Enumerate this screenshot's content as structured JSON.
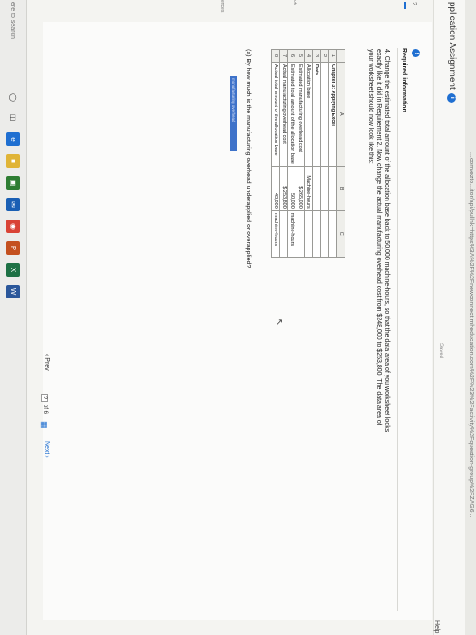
{
  "browser": {
    "url_fragment": "...com/ezto...itor/api/pullnk=https%3A%2F%2Fnewconnect.mheducation.com%2F%23%2Factivity%2Fquestion-group%2FZAG6..."
  },
  "header": {
    "title": "pplication Assignment",
    "info_icon": "i",
    "saved": "Saved",
    "help": "Help"
  },
  "left_nav": {
    "question_number": "2",
    "marks": [
      "ok",
      "ences"
    ]
  },
  "content": {
    "required_icon": "!",
    "required_title": "Required information",
    "instruction": "4. Change the estimated total amount of the allocation base back to 50,000 machine-hours, so that the data area of you worksheet looks exactly like it did in Requirement 2. Now change the actual manufacturing overhead cost from $248,000 to $253,800. The data area of your worksheet should now look like this:",
    "sheet": {
      "columns": [
        "A",
        "B",
        "C"
      ],
      "rows": [
        {
          "n": "1",
          "a": "Chapter 3: Applying Excel",
          "b": "",
          "c": ""
        },
        {
          "n": "2",
          "a": "",
          "b": "",
          "c": ""
        },
        {
          "n": "3",
          "a": "Data",
          "b": "",
          "c": ""
        },
        {
          "n": "4",
          "a": "Allocation base",
          "b": "Machine-hours",
          "c": ""
        },
        {
          "n": "5",
          "a": "Estimated manufacturing overhead cost",
          "b": "$      265,000",
          "c": ""
        },
        {
          "n": "6",
          "a": "Estimated total amount of the allocation base",
          "b": "50,000",
          "c": "machine-hours"
        },
        {
          "n": "7",
          "a": "Actual manufacturing overhead cost",
          "b": "$      253,800",
          "c": ""
        },
        {
          "n": "8",
          "a": "Actual total amount of the allocation base",
          "b": "43,000",
          "c": "machine-hours"
        }
      ]
    },
    "question": "(a) By how much is the manufacturing overhead underapplied or overapplied?",
    "answer_label": "manufacturing overhead"
  },
  "pager": {
    "prev": "Prev",
    "current": "2",
    "of": "of 6",
    "next": "Next"
  },
  "taskbar": {
    "search_placeholder": "ere to search",
    "icons": [
      "windows-icon",
      "task-view-icon",
      "edge-icon",
      "file-explorer-icon",
      "store-icon",
      "mail-icon",
      "chrome-icon",
      "powerpoint-icon",
      "excel-icon",
      "word-icon"
    ]
  },
  "colors": {
    "accent": "#1f6fd1",
    "answer_box": "#3e72c9"
  }
}
